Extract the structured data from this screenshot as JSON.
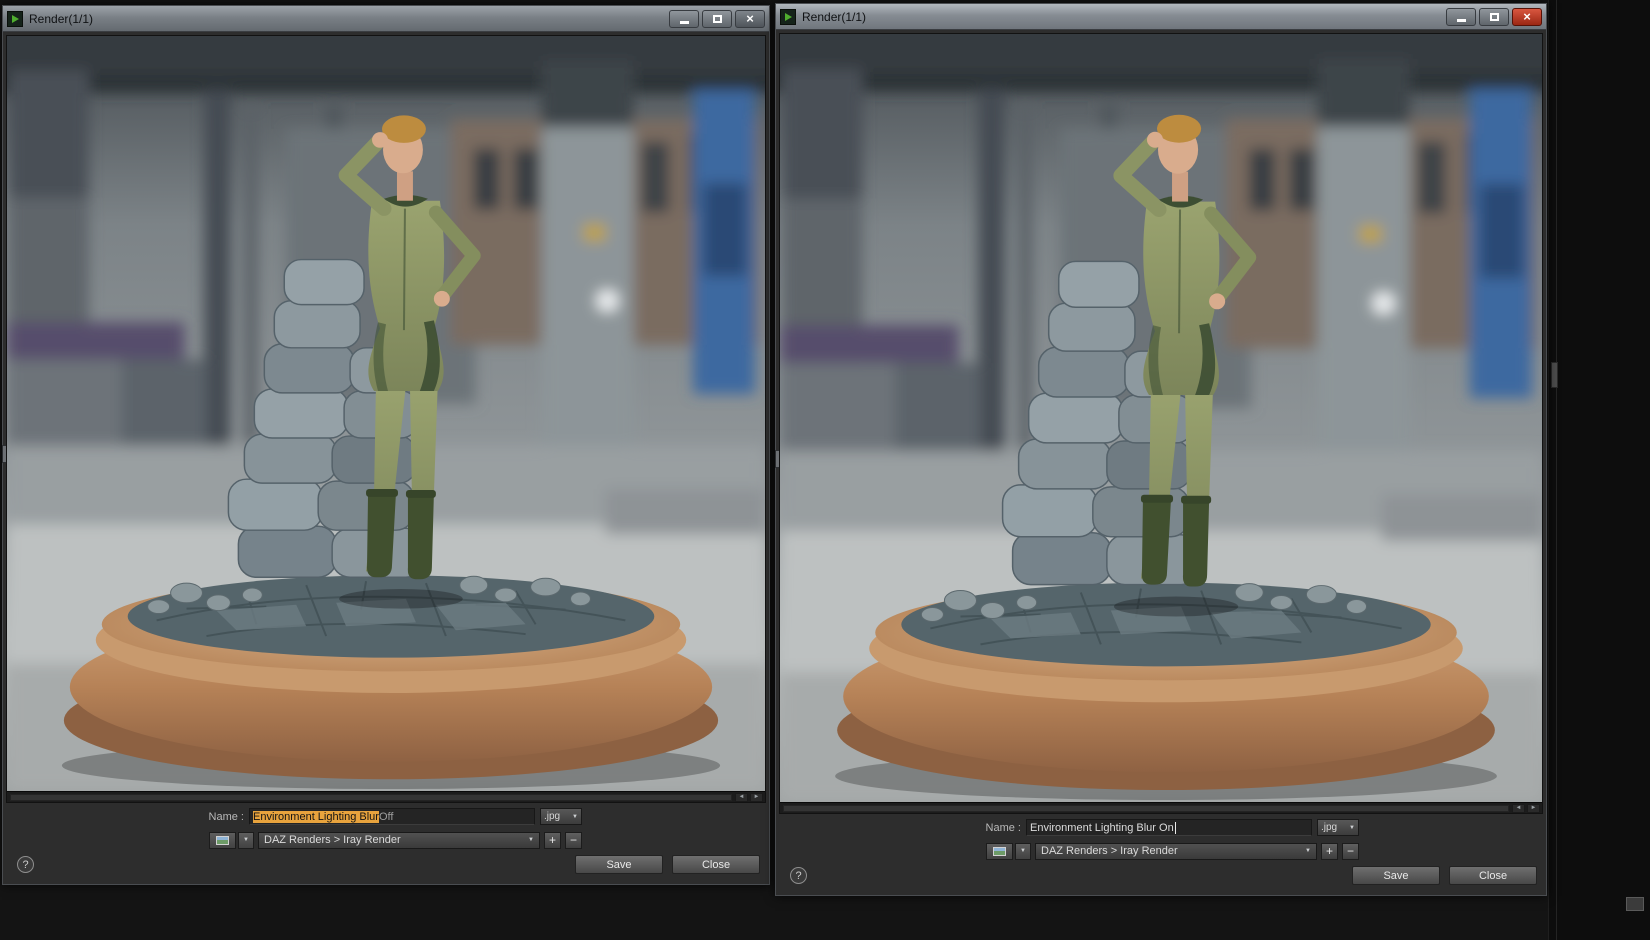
{
  "icons": {
    "dropdown_arrow": "▼",
    "scroll_left_arrow": "◄",
    "scroll_right_arrow": "►",
    "close_glyph": "×",
    "help_glyph": "?",
    "plus_glyph": "+",
    "minus_glyph": "−"
  },
  "colors": {
    "selection_highlight": "#e8a33d",
    "active_close_button": "#c23b2e"
  },
  "windows": {
    "left": {
      "title": "Render(1/1)",
      "name_label": "Name :",
      "name_value_selected": "Environment Lighting Blur",
      "name_value_tail": " Off",
      "format_value": ".jpg",
      "folder_value": "DAZ Renders > Iray Render",
      "save_label": "Save",
      "close_label": "Close"
    },
    "right": {
      "title": "Render(1/1)",
      "name_label": "Name :",
      "name_value": "Environment Lighting Blur On",
      "format_value": ".jpg",
      "folder_value": "DAZ Renders > Iray Render",
      "save_label": "Save",
      "close_label": "Close"
    }
  }
}
